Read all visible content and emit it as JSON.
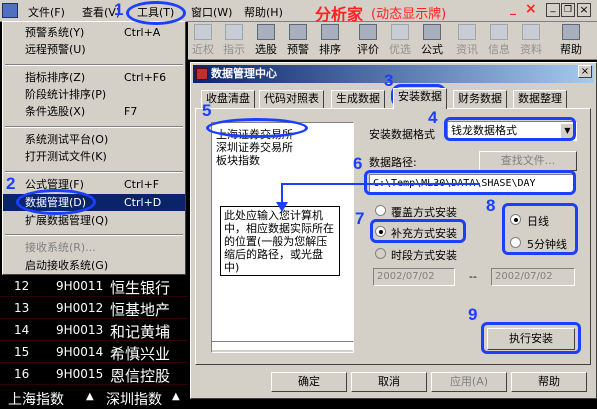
{
  "menubar": {
    "items": [
      "文件(F)",
      "查看(V)",
      "工具(T)",
      "窗口(W)",
      "帮助(H)"
    ],
    "brand": "分析家",
    "brand_sub": "(动态显示牌)"
  },
  "toolbar": {
    "buttons": [
      "近权",
      "指示",
      "选股",
      "预警",
      "排序",
      "评价",
      "优选",
      "公式",
      "资讯",
      "信息",
      "资料",
      "帮助"
    ]
  },
  "menu": {
    "items": [
      {
        "label": "预警系统(Y)",
        "shortcut": "Ctrl+A"
      },
      {
        "label": "远程预警(U)",
        "shortcut": ""
      },
      {
        "label": "指标排序(Z)",
        "shortcut": "Ctrl+F6"
      },
      {
        "label": "阶段统计排序(P)",
        "shortcut": ""
      },
      {
        "label": "条件选股(X)",
        "shortcut": "F7"
      },
      {
        "label": "系统测试平台(O)",
        "shortcut": ""
      },
      {
        "label": "打开测试文件(K)",
        "shortcut": ""
      },
      {
        "label": "公式管理(F)",
        "shortcut": "Ctrl+F"
      },
      {
        "label": "数据管理(D)",
        "shortcut": "Ctrl+D"
      },
      {
        "label": "扩展数据管理(Q)",
        "shortcut": ""
      },
      {
        "label": "接收系统(R)...",
        "shortcut": ""
      },
      {
        "label": "启动接收系统(G)",
        "shortcut": ""
      }
    ]
  },
  "stocks": [
    {
      "no": "12",
      "code": "9H0011",
      "name": "恒生银行"
    },
    {
      "no": "13",
      "code": "9H0012",
      "name": "恒基地产"
    },
    {
      "no": "14",
      "code": "9H0013",
      "name": "和记黄埔"
    },
    {
      "no": "15",
      "code": "9H0014",
      "name": "希慎兴业"
    },
    {
      "no": "16",
      "code": "9H0015",
      "name": "恩信控股"
    }
  ],
  "bottom_tabs": [
    "上海指数",
    "深圳指数"
  ],
  "dialog": {
    "title": "数据管理中心",
    "tabs": [
      "收盘清盘",
      "代码对照表",
      "生成数据",
      "安装数据",
      "财务数据",
      "数据整理"
    ],
    "exchanges": [
      "上海证券交易所",
      "深圳证券交易所",
      "板块指数"
    ],
    "format_label": "安装数据格式",
    "format_value": "钱龙数据格式",
    "path_label": "数据路径:",
    "find_button": "查找文件...",
    "path_value": "C:\\Temp\\ML30\\DATA\\SHASE\\DAY",
    "mode_options": [
      "覆盖方式安装",
      "补充方式安装",
      "时段方式安装"
    ],
    "period_options": [
      "日线",
      "5分钟线"
    ],
    "date_from": "2002/07/02",
    "date_sep": "--",
    "date_to": "2002/07/02",
    "note": "此处应输入您计算机中，相应数据实际所在的位置(一般为您解压缩后的路径，或光盘中)",
    "execute_button": "执行安装",
    "ok_button": "确定",
    "cancel_button": "取消",
    "apply_button": "应用(A)",
    "help_button": "帮助"
  },
  "annotations": [
    "1",
    "2",
    "3",
    "4",
    "5",
    "6",
    "7",
    "8",
    "9"
  ],
  "colors": {
    "annotation": "#1a3fff",
    "brand": "#ff2020",
    "selection": "#0a246a"
  }
}
